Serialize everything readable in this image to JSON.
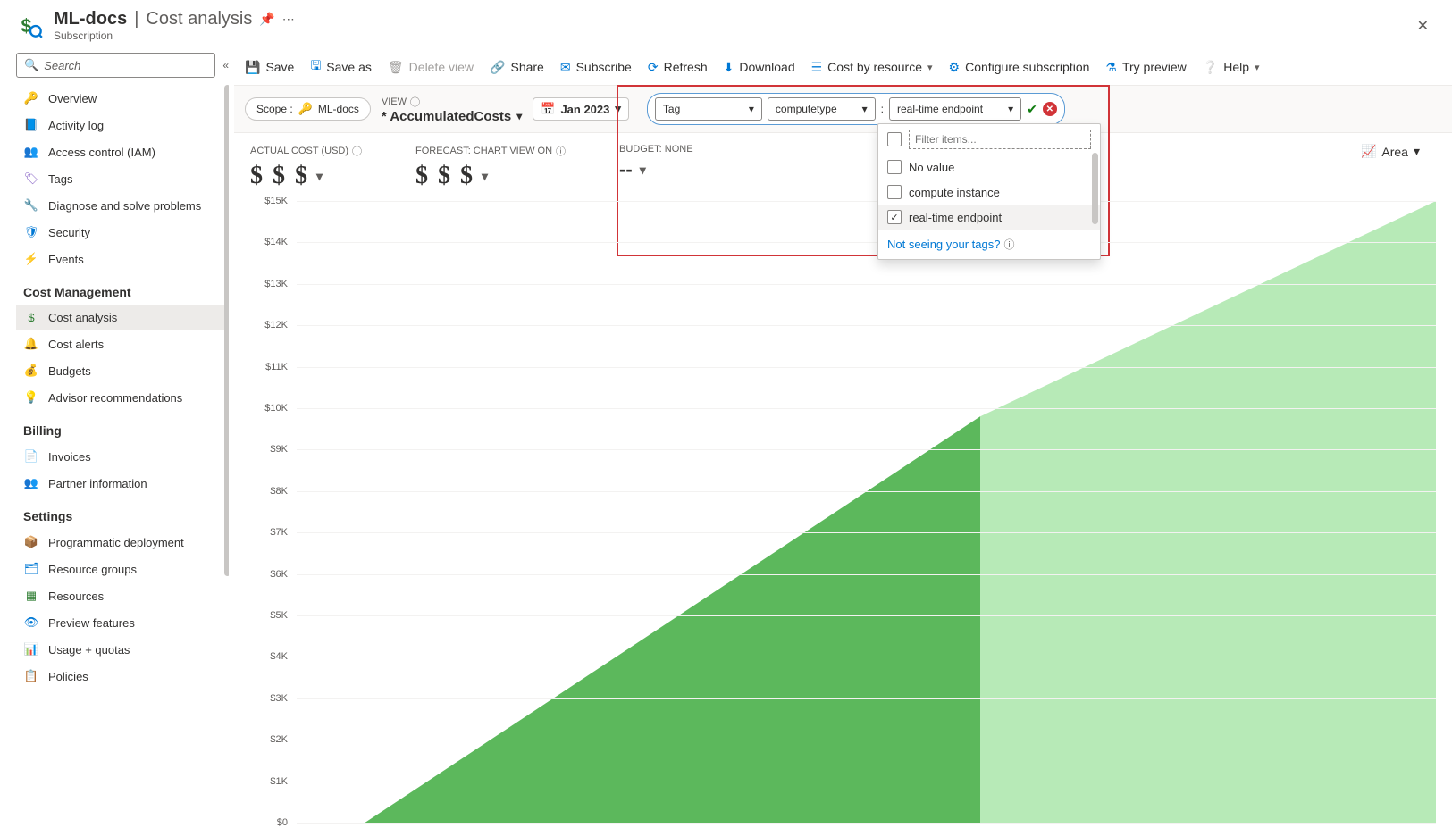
{
  "header": {
    "title_scope": "ML-docs",
    "title_page": "Cost analysis",
    "subtitle": "Subscription"
  },
  "sidebar": {
    "search_placeholder": "Search",
    "group_top": [
      {
        "label": "Overview",
        "icon": "key"
      },
      {
        "label": "Activity log",
        "icon": "log"
      },
      {
        "label": "Access control (IAM)",
        "icon": "people"
      },
      {
        "label": "Tags",
        "icon": "tag"
      },
      {
        "label": "Diagnose and solve problems",
        "icon": "wrench"
      },
      {
        "label": "Security",
        "icon": "shield"
      },
      {
        "label": "Events",
        "icon": "bolt"
      }
    ],
    "section_cost": "Cost Management",
    "group_cost": [
      {
        "label": "Cost analysis",
        "icon": "cost",
        "active": true
      },
      {
        "label": "Cost alerts",
        "icon": "alert"
      },
      {
        "label": "Budgets",
        "icon": "budget"
      },
      {
        "label": "Advisor recommendations",
        "icon": "advisor"
      }
    ],
    "section_billing": "Billing",
    "group_billing": [
      {
        "label": "Invoices",
        "icon": "invoice"
      },
      {
        "label": "Partner information",
        "icon": "people"
      }
    ],
    "section_settings": "Settings",
    "group_settings": [
      {
        "label": "Programmatic deployment",
        "icon": "deploy"
      },
      {
        "label": "Resource groups",
        "icon": "rg"
      },
      {
        "label": "Resources",
        "icon": "grid"
      },
      {
        "label": "Preview features",
        "icon": "preview"
      },
      {
        "label": "Usage + quotas",
        "icon": "usage"
      },
      {
        "label": "Policies",
        "icon": "policy"
      }
    ]
  },
  "toolbar": {
    "save": "Save",
    "save_as": "Save as",
    "delete_view": "Delete view",
    "share": "Share",
    "subscribe": "Subscribe",
    "refresh": "Refresh",
    "download": "Download",
    "cost_by_resource": "Cost by resource",
    "configure": "Configure subscription",
    "try_preview": "Try preview",
    "help": "Help"
  },
  "filterbar": {
    "scope_label": "Scope :",
    "scope_value": "ML-docs",
    "view_label": "VIEW",
    "view_name": "* AccumulatedCosts",
    "date": "Jan 2023",
    "tag_dropdown": "Tag",
    "tag_key": "computetype",
    "tag_value": "real-time endpoint",
    "filter_placeholder": "Filter items...",
    "options": [
      {
        "label": "No value",
        "checked": false
      },
      {
        "label": "compute instance",
        "checked": false
      },
      {
        "label": "real-time endpoint",
        "checked": true
      }
    ],
    "not_seeing": "Not seeing your tags?"
  },
  "kpi": {
    "actual_label": "ACTUAL COST (USD)",
    "actual_val": "$ $ $",
    "forecast_label": "FORECAST: CHART VIEW ON",
    "forecast_val": "$ $ $",
    "budget_label": "BUDGET: NONE",
    "budget_val": "--",
    "area_toggle": "Area"
  },
  "chart_data": {
    "type": "area",
    "ylabel": "",
    "ylim": [
      0,
      15000
    ],
    "y_ticks": [
      "$0",
      "$1K",
      "$2K",
      "$3K",
      "$4K",
      "$5K",
      "$6K",
      "$7K",
      "$8K",
      "$9K",
      "$10K",
      "$11K",
      "$12K",
      "$13K",
      "$14K",
      "$15K"
    ],
    "series": [
      {
        "name": "actual",
        "color": "#5cb85c",
        "x": [
          0,
          0.6
        ],
        "values": [
          0,
          9800
        ]
      },
      {
        "name": "forecast",
        "color": "#a8e6a8",
        "x": [
          0.6,
          1.0
        ],
        "values": [
          9800,
          15000
        ]
      }
    ]
  },
  "colors": {
    "actual_area": "#5cb85c",
    "forecast_area": "#b7eab7",
    "accent_blue": "#0078d4",
    "danger": "#d13438"
  }
}
